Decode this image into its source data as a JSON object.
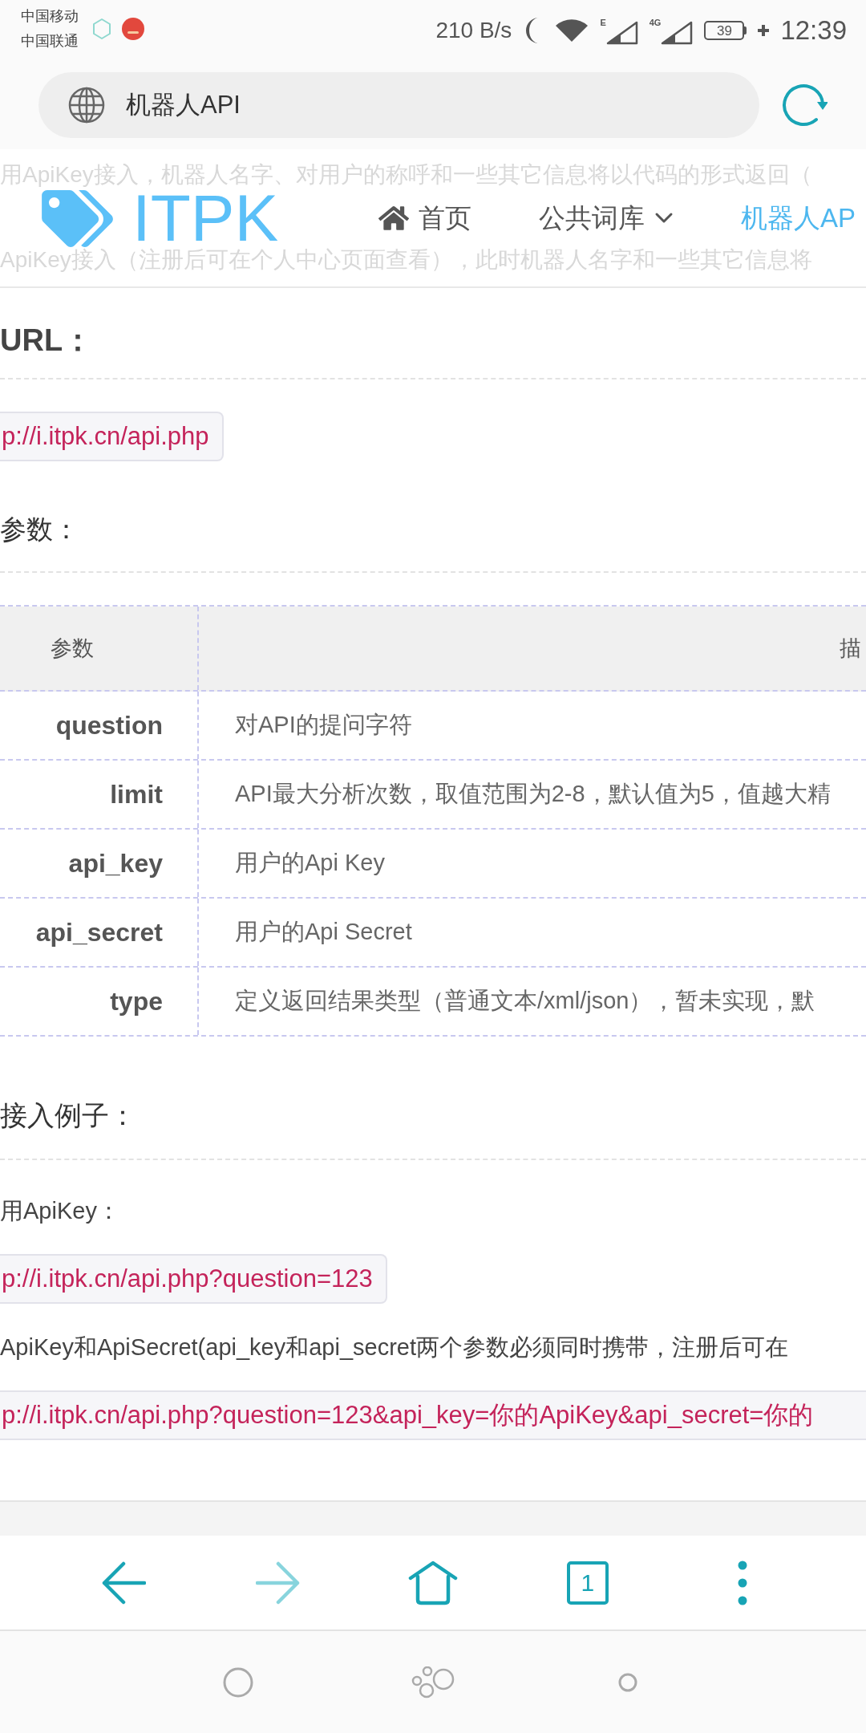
{
  "status_bar": {
    "carriers": [
      "中国移动",
      "中国联通"
    ],
    "network_speed": "210 B/s",
    "signals": [
      {
        "label": "E"
      },
      {
        "label": "4G"
      }
    ],
    "battery": "39",
    "time": "12:39"
  },
  "address_bar": {
    "value": "机器人API"
  },
  "page": {
    "background_text": [
      "用ApiKey接入，机器人名字、对用户的称呼和一些其它信息将以代码的形式返回（",
      "ApiKey接入（注册后可在个人中心页面查看），此时机器人名字和一些其它信息将"
    ],
    "header": {
      "logo": "ITPK",
      "nav": [
        {
          "kind": "icon",
          "label": "首页",
          "selected": false
        },
        {
          "kind": "dropdown",
          "label": "公共词库",
          "selected": false
        },
        {
          "kind": "plain",
          "label": "机器人AP",
          "selected": true
        }
      ]
    },
    "url_section": {
      "heading": "URL：",
      "code": "p://i.itpk.cn/api.php"
    },
    "params_section": {
      "heading": "参数：",
      "table": {
        "columns": [
          "参数",
          "描"
        ],
        "rows": [
          {
            "name": "question",
            "description": "对API的提问字符"
          },
          {
            "name": "limit",
            "description": "API最大分析次数，取值范围为2-8，默认值为5，值越大精"
          },
          {
            "name": "api_key",
            "description": "用户的Api Key"
          },
          {
            "name": "api_secret",
            "description": "用户的Api Secret"
          },
          {
            "name": "type",
            "description": "定义返回结果类型（普通文本/xml/json），暂未实现，默"
          }
        ]
      }
    },
    "examples_section": {
      "heading": "接入例子：",
      "items": [
        {
          "kind": "text",
          "text": "用ApiKey："
        },
        {
          "kind": "code",
          "text": "p://i.itpk.cn/api.php?question=123"
        },
        {
          "kind": "text",
          "text": "ApiKey和ApiSecret(api_key和api_secret两个参数必须同时携带，注册后可在"
        },
        {
          "kind": "code",
          "text": "p://i.itpk.cn/api.php?question=123&api_key=你的ApiKey&api_secret=你的"
        }
      ]
    }
  },
  "browser_toolbar": {
    "buttons": [
      {
        "kind": "back",
        "disabled": false
      },
      {
        "kind": "forward",
        "disabled": true
      },
      {
        "kind": "home",
        "disabled": false
      },
      {
        "kind": "tabs",
        "count": "1",
        "disabled": false
      },
      {
        "kind": "more",
        "disabled": false
      }
    ]
  }
}
